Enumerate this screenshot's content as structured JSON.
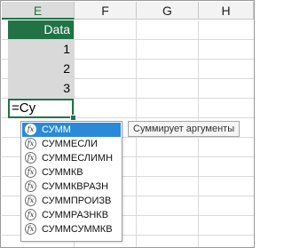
{
  "columns": [
    "E",
    "F",
    "G",
    "H"
  ],
  "active_column": "E",
  "cells": {
    "header": "Data",
    "values": [
      "1",
      "2",
      "3"
    ],
    "editing_text": "=Cy"
  },
  "autocomplete": {
    "items": [
      "СУММ",
      "СУММЕСЛИ",
      "СУММЕСЛИМН",
      "СУММКВ",
      "СУММКВРАЗН",
      "СУММПРОИЗВ",
      "СУММРАЗНКВ",
      "СУММСУММКВ"
    ],
    "selected_index": 0,
    "icon": "fx-function-icon",
    "tooltip": "Суммирует аргументы"
  },
  "colors": {
    "accent": "#217346",
    "selected_item": "#2a8ad7",
    "data_fill": "#d9d9d9"
  }
}
